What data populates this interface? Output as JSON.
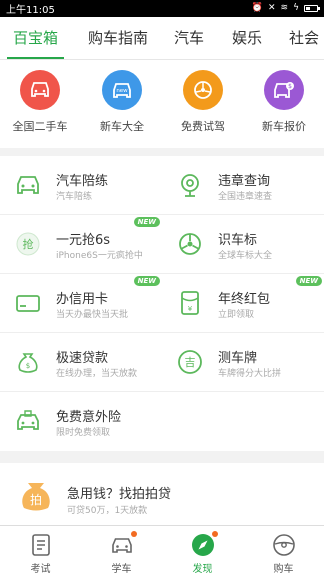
{
  "status": {
    "time": "上午11:05"
  },
  "tabs": [
    {
      "label": "百宝箱"
    },
    {
      "label": "购车指南"
    },
    {
      "label": "汽车"
    },
    {
      "label": "娱乐"
    },
    {
      "label": "社会"
    }
  ],
  "quick": [
    {
      "label": "全国二手车",
      "color": "#f0554a",
      "icon": "car-icon"
    },
    {
      "label": "新车大全",
      "color": "#3e98e8",
      "icon": "new-car-icon"
    },
    {
      "label": "免费试驾",
      "color": "#f39a1b",
      "icon": "steering-wheel-icon"
    },
    {
      "label": "新车报价",
      "color": "#9b58d4",
      "icon": "car-price-icon"
    }
  ],
  "services": [
    {
      "title": "汽车陪练",
      "sub": "汽车陪练",
      "icon": "car-outline-icon"
    },
    {
      "title": "违章查询",
      "sub": "全国违章速查",
      "icon": "camera-icon"
    },
    {
      "title": "一元抢6s",
      "sub": "iPhone6S一元疯抢中",
      "icon": "grab-icon",
      "badge": "NEW"
    },
    {
      "title": "识车标",
      "sub": "全球车标大全",
      "icon": "steering-icon"
    },
    {
      "title": "办信用卡",
      "sub": "当天办最快当天批",
      "icon": "credit-card-icon",
      "badge": "NEW"
    },
    {
      "title": "年终红包",
      "sub": "立即领取",
      "icon": "red-packet-icon",
      "badge": "NEW"
    },
    {
      "title": "极速贷款",
      "sub": "在线办理，当天放款",
      "icon": "money-bag-icon"
    },
    {
      "title": "测车牌",
      "sub": "车牌得分大比拼",
      "icon": "license-plate-icon"
    },
    {
      "title": "免费意外险",
      "sub": "限时免费领取",
      "icon": "insurance-car-icon"
    }
  ],
  "loan": {
    "title": "急用钱？找拍拍贷",
    "sub": "可贷50万，1天放款",
    "logo_text": "拍"
  },
  "nav": [
    {
      "label": "考试",
      "icon": "exam-icon"
    },
    {
      "label": "学车",
      "icon": "learn-car-icon"
    },
    {
      "label": "发现",
      "icon": "compass-icon"
    },
    {
      "label": "购车",
      "icon": "buy-car-icon"
    }
  ],
  "colors": {
    "accent": "#27a74a",
    "icon_green": "#5cb85c",
    "badge": "#5cc05c",
    "notify_dot": "#f26b22"
  }
}
